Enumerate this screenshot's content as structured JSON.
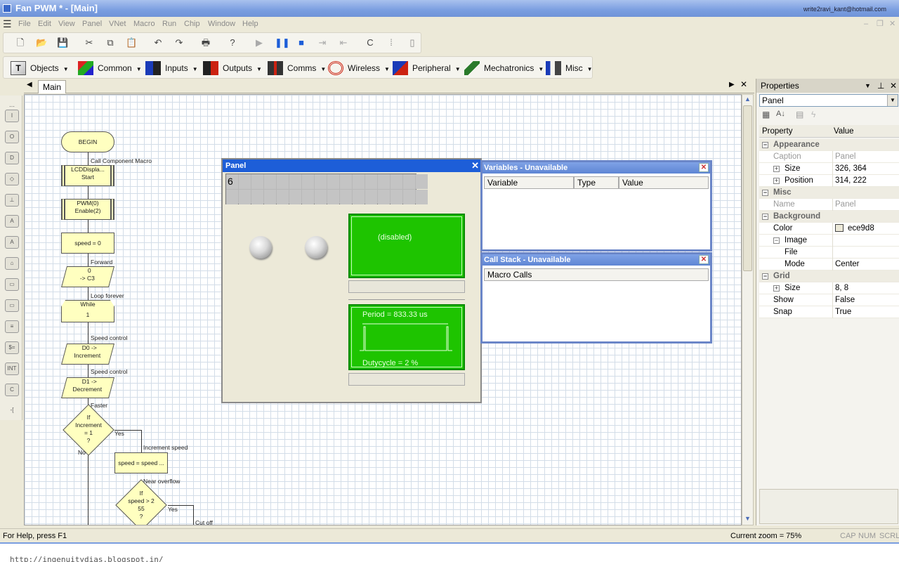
{
  "window": {
    "title": "Fan PWM * - [Main]",
    "user_email": "write2ravi_kant@hotmail.com"
  },
  "menu": [
    "File",
    "Edit",
    "View",
    "Panel",
    "VNet",
    "Macro",
    "Run",
    "Chip",
    "Window",
    "Help"
  ],
  "component_toolbar": [
    {
      "label": "Objects",
      "icon": "objects-icon"
    },
    {
      "label": "Common",
      "icon": "common-icon"
    },
    {
      "label": "Inputs",
      "icon": "inputs-icon"
    },
    {
      "label": "Outputs",
      "icon": "outputs-icon"
    },
    {
      "label": "Comms",
      "icon": "comms-icon"
    },
    {
      "label": "Wireless",
      "icon": "wireless-icon"
    },
    {
      "label": "Peripheral",
      "icon": "peripheral-icon"
    },
    {
      "label": "Mechatronics",
      "icon": "mechatronics-icon"
    },
    {
      "label": "Misc",
      "icon": "misc-icon"
    }
  ],
  "doc_tab": {
    "label": "Main"
  },
  "flowchart": {
    "begin": "BEGIN",
    "call_label": "Call Component Macro",
    "lcd_box": [
      "LCDDispla...",
      "Start"
    ],
    "pwm_box": [
      "PWM(0)",
      "Enable(2)"
    ],
    "speed_box": "speed = 0",
    "forward_label": "Forward",
    "output_box": [
      "0",
      "-> C3"
    ],
    "loop_label": "Loop forever",
    "while_box": [
      "While",
      "1"
    ],
    "speed_control_label": "Speed control",
    "d0_box": [
      "D0 ->",
      "Increment"
    ],
    "speed_control_label2": "Speed control",
    "d1_box": [
      "D1 ->",
      "Decrement"
    ],
    "faster_label": "Faster",
    "if1": [
      "If",
      "Increment",
      "= 1",
      "?"
    ],
    "yes1": "Yes",
    "no1": "No",
    "increment_label": "Increment speed",
    "speed_calc": "speed = speed ...",
    "near_overflow": "Near overflow",
    "if2": [
      "If",
      "speed > 2",
      "55",
      "?"
    ],
    "yes2": "Yes",
    "cutoff": "Cut off"
  },
  "panel": {
    "title": "Panel",
    "lcd_char": "6",
    "disabled_text": "(disabled)",
    "period_text": "Period =  833.33 us",
    "duty_text": "Dutycycle =  2 %"
  },
  "variables": {
    "title": "Variables - Unavailable",
    "columns": [
      "Variable",
      "Type",
      "Value"
    ]
  },
  "callstack": {
    "title": "Call Stack - Unavailable",
    "column": "Macro Calls"
  },
  "properties": {
    "title": "Properties",
    "object": "Panel",
    "col_property": "Property",
    "col_value": "Value",
    "rows": [
      {
        "k": "Appearance",
        "v": "",
        "type": "cat"
      },
      {
        "k": "Caption",
        "v": "Panel",
        "type": "dim"
      },
      {
        "k": "Size",
        "v": "326, 364",
        "type": "exp"
      },
      {
        "k": "Position",
        "v": "314, 222",
        "type": "exp"
      },
      {
        "k": "Misc",
        "v": "",
        "type": "cat"
      },
      {
        "k": "Name",
        "v": "Panel",
        "type": "dim"
      },
      {
        "k": "Background",
        "v": "",
        "type": "cat"
      },
      {
        "k": "Color",
        "v": "ece9d8",
        "type": "color"
      },
      {
        "k": "Image",
        "v": "",
        "type": "sub"
      },
      {
        "k": "File",
        "v": "",
        "type": "sub2"
      },
      {
        "k": "Mode",
        "v": "Center",
        "type": "sub2"
      },
      {
        "k": "Grid",
        "v": "",
        "type": "cat"
      },
      {
        "k": "Size",
        "v": "8, 8",
        "type": "exp"
      },
      {
        "k": "Show",
        "v": "False",
        "type": "plain"
      },
      {
        "k": "Snap",
        "v": "True",
        "type": "plain"
      }
    ]
  },
  "status": {
    "help": "For Help, press F1",
    "zoom": "Current zoom = 75%",
    "cap": "CAP",
    "num": "NUM",
    "scrl": "SCRL"
  },
  "footer": {
    "blog": "http://ingenuitydias.blogspot.in/"
  },
  "colors": {
    "panel_bg": "#ece9d8",
    "scope_green": "#1ec400",
    "title_blue": "#1d5ed8"
  }
}
